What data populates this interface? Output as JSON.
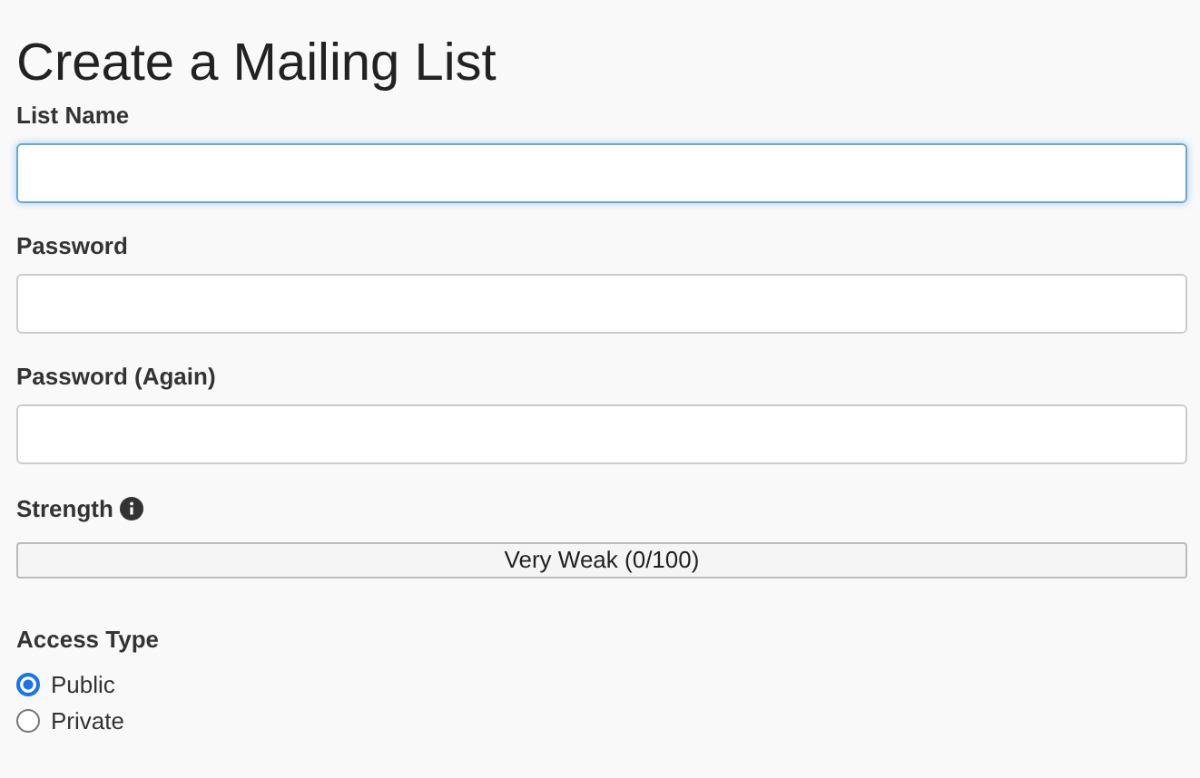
{
  "title": "Create a Mailing List",
  "fields": [
    {
      "label": "List Name",
      "focused": true
    },
    {
      "label": "Password",
      "focused": false
    },
    {
      "label": "Password (Again)",
      "focused": false
    }
  ],
  "strength": {
    "label": "Strength",
    "level": 0,
    "reading": "Very Weak (0/100)"
  },
  "access_type": {
    "label": "Access Type",
    "options": [
      {
        "label": "Public",
        "selected": true
      },
      {
        "label": "Private",
        "selected": false
      }
    ]
  }
}
